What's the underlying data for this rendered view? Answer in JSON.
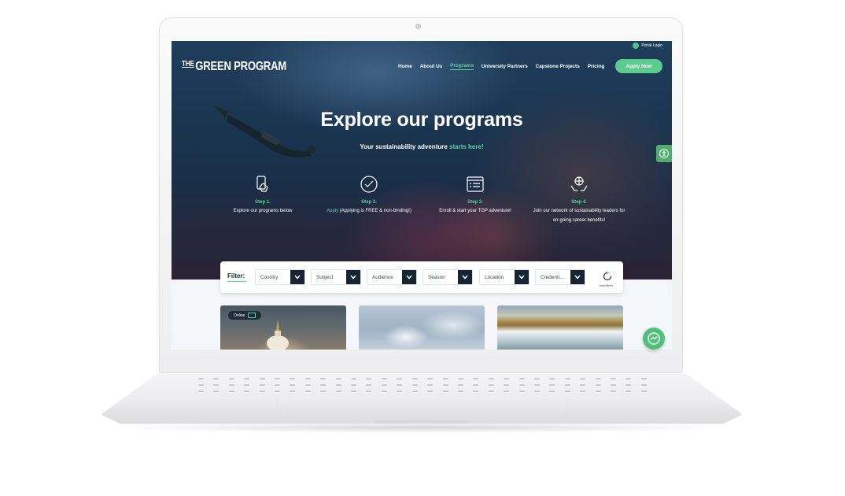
{
  "header": {
    "portal_login": "Portal Login",
    "logo_the": "THE",
    "logo_text": "GREEN PROGRAM",
    "nav": [
      "Home",
      "About Us",
      "Programs",
      "University Partners",
      "Capstone Projects",
      "Pricing"
    ],
    "active_nav": "Programs",
    "apply_button": "Apply Now"
  },
  "hero": {
    "title": "Explore our programs",
    "subtitle_lead": "Your sustainability adventure ",
    "subtitle_accent": "starts here!"
  },
  "steps": [
    {
      "num": "Step 1.",
      "desc": "Explore our programs below",
      "icon": "tablet-touch-icon"
    },
    {
      "num": "Step 2.",
      "desc_accent": "Apply",
      "desc": " (Applying is FREE & non-binding!)",
      "icon": "check-circle-icon"
    },
    {
      "num": "Step 3.",
      "desc": "Enroll & start your TGP adventure!",
      "icon": "checklist-window-icon"
    },
    {
      "num": "Step 4.",
      "desc": "Join our network of sustainability leaders for on-going career benefits!",
      "icon": "globe-hands-icon"
    }
  ],
  "filter": {
    "label": "Filter:",
    "dropdowns": [
      "Country",
      "Subject",
      "Audience",
      "Season",
      "Location",
      "Credenti..."
    ],
    "reset_label": "reset filters"
  },
  "cards": [
    {
      "badge": "Online"
    },
    {},
    {}
  ],
  "colors": {
    "accent_green": "#58d39a",
    "button_green": "#5ccb8e",
    "dropdown_dark": "#182433"
  }
}
